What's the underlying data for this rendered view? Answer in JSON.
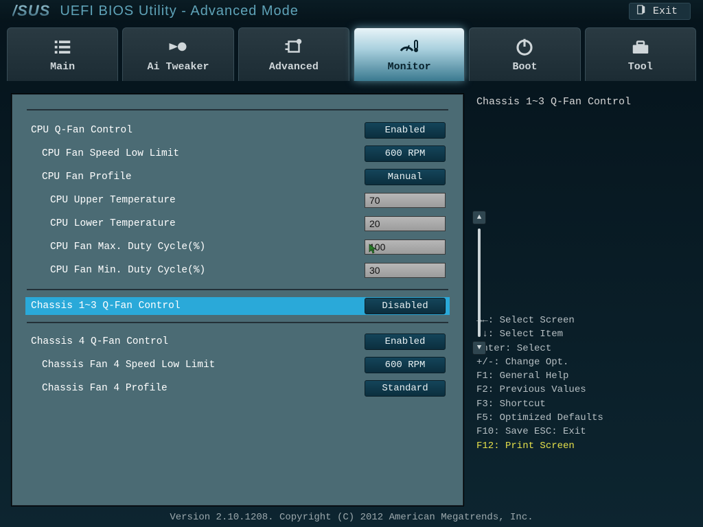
{
  "header": {
    "brand": "/SUS",
    "title": "UEFI BIOS Utility - Advanced Mode",
    "exit_label": "Exit"
  },
  "tabs": [
    {
      "id": "main",
      "label": "Main",
      "icon": "list-icon"
    },
    {
      "id": "ai",
      "label": "Ai Tweaker",
      "icon": "comet-icon"
    },
    {
      "id": "advanced",
      "label": "Advanced",
      "icon": "chip-icon"
    },
    {
      "id": "monitor",
      "label": "Monitor",
      "icon": "gauge-thermo-icon",
      "active": true
    },
    {
      "id": "boot",
      "label": "Boot",
      "icon": "power-icon"
    },
    {
      "id": "tool",
      "label": "Tool",
      "icon": "toolbox-icon"
    }
  ],
  "panel": {
    "cpu_qfan": {
      "label": "CPU Q-Fan Control",
      "value": "Enabled"
    },
    "cpu_speed_low": {
      "label": "CPU Fan Speed Low Limit",
      "value": "600 RPM"
    },
    "cpu_profile": {
      "label": "CPU Fan Profile",
      "value": "Manual"
    },
    "cpu_upper_temp": {
      "label": "CPU Upper Temperature",
      "value": "70"
    },
    "cpu_lower_temp": {
      "label": "CPU Lower Temperature",
      "value": "20"
    },
    "cpu_max_duty": {
      "label": "CPU Fan Max. Duty Cycle(%)",
      "value": "100"
    },
    "cpu_min_duty": {
      "label": "CPU Fan Min. Duty Cycle(%)",
      "value": "30"
    },
    "chassis13": {
      "label": "Chassis 1~3 Q-Fan Control",
      "value": "Disabled"
    },
    "chassis4_qfan": {
      "label": "Chassis 4 Q-Fan Control",
      "value": "Enabled"
    },
    "chassis4_low": {
      "label": "Chassis Fan 4 Speed Low Limit",
      "value": "600 RPM"
    },
    "chassis4_profile": {
      "label": "Chassis Fan 4 Profile",
      "value": "Standard"
    }
  },
  "sidebar": {
    "title": "Chassis 1~3 Q-Fan Control",
    "hints": [
      "→←: Select Screen",
      "↑↓: Select Item",
      "Enter: Select",
      "+/-: Change Opt.",
      "F1: General Help",
      "F2: Previous Values",
      "F3: Shortcut",
      "F5: Optimized Defaults",
      "F10: Save  ESC: Exit"
    ],
    "hint_highlight": "F12: Print Screen"
  },
  "footer": "Version 2.10.1208. Copyright (C) 2012 American Megatrends, Inc."
}
